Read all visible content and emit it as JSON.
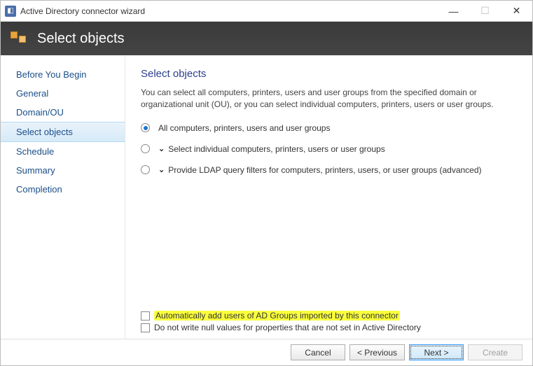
{
  "window": {
    "title": "Active Directory connector wizard"
  },
  "banner": {
    "title": "Select objects"
  },
  "sidebar": {
    "items": [
      {
        "label": "Before You Begin"
      },
      {
        "label": "General"
      },
      {
        "label": "Domain/OU"
      },
      {
        "label": "Select objects"
      },
      {
        "label": "Schedule"
      },
      {
        "label": "Summary"
      },
      {
        "label": "Completion"
      }
    ],
    "selectedIndex": 3
  },
  "content": {
    "heading": "Select objects",
    "description": "You can select all computers, printers, users and user groups from the specified domain or organizational unit (OU), or you can select individual computers, printers, users or user groups.",
    "options": [
      {
        "label": "All computers, printers, users and user groups",
        "expandable": false,
        "checked": true
      },
      {
        "label": "Select individual computers, printers, users or user groups",
        "expandable": true,
        "checked": false
      },
      {
        "label": "Provide LDAP query filters for computers, printers, users, or user groups (advanced)",
        "expandable": true,
        "checked": false
      }
    ],
    "checkboxes": [
      {
        "label": "Automatically add users of AD Groups imported by this connector",
        "checked": false,
        "highlight": true
      },
      {
        "label": "Do not write null values for properties that are not set in Active Directory",
        "checked": false,
        "highlight": false
      }
    ]
  },
  "footer": {
    "cancel": "Cancel",
    "previous": "< Previous",
    "next": "Next >",
    "create": "Create"
  }
}
